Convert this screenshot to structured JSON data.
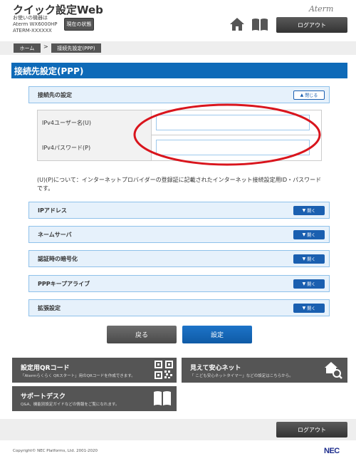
{
  "header": {
    "app_title": "クイック設定Web",
    "device_label": "お使いの機器は",
    "device_model": "Aterm WX6000HP",
    "device_id": "ATERM-XXXXXX",
    "status_button": "現在の状態",
    "brand": "Aterm",
    "logout": "ログアウト"
  },
  "breadcrumb": {
    "home": "ホーム",
    "separator": ">",
    "current": "接続先設定(PPP)"
  },
  "page": {
    "title": "接続先設定(PPP)"
  },
  "connection": {
    "section_label": "接続先の設定",
    "toggle_label": "閉じる",
    "username_label": "IPv4ユーザー名(U)",
    "username_value": "",
    "password_label": "IPv4パスワード(P)",
    "password_value": "",
    "note": "(U)(P)について：インターネットプロバイダーの登録証に記載されたインターネット接続設定用ID・パスワードです。"
  },
  "sections": [
    {
      "label": "IPアドレス",
      "toggle": "開く"
    },
    {
      "label": "ネームサーバ",
      "toggle": "開く"
    },
    {
      "label": "認証時の暗号化",
      "toggle": "開く"
    },
    {
      "label": "PPPキープアライブ",
      "toggle": "開く"
    },
    {
      "label": "拡張設定",
      "toggle": "開く"
    }
  ],
  "actions": {
    "back": "戻る",
    "apply": "設定"
  },
  "tiles": {
    "qr_title": "設定用QRコード",
    "qr_desc": "「Atermらくらく QRスタート」用のQRコードを作成できます。",
    "mimamori_title": "見えて安心ネット",
    "mimamori_desc": "「 こども安心ネットタイマー」などの設定はこちらから。",
    "support_title": "サポートデスク",
    "support_desc": "Q&A、機能別設定ガイドなどの情報をご覧になれます。"
  },
  "footer": {
    "logout": "ログアウト",
    "copyright": "Copyright© NEC Platforms, Ltd. 2001-2020",
    "brand": "NEC"
  },
  "colors": {
    "accent": "#0e6ab8",
    "section_bg": "#e6f1fb",
    "highlight_oval": "#d9151d"
  }
}
